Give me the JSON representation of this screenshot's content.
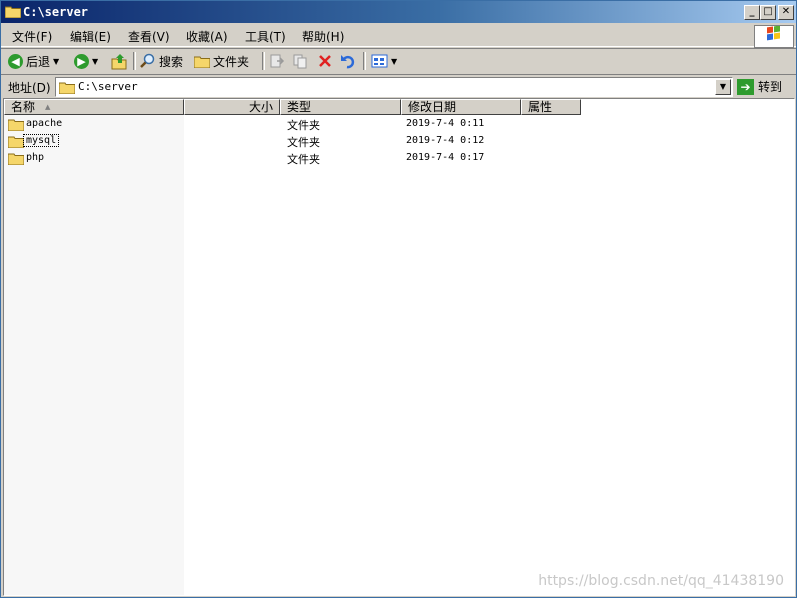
{
  "window": {
    "title": "C:\\server",
    "controls": {
      "minimize": "_",
      "maximize": "□",
      "close": "✕"
    }
  },
  "menu": [
    "文件(F)",
    "编辑(E)",
    "查看(V)",
    "收藏(A)",
    "工具(T)",
    "帮助(H)"
  ],
  "toolbar": {
    "back": "后退",
    "search": "搜索",
    "folders": "文件夹"
  },
  "address": {
    "label": "地址(D)",
    "value": "C:\\server",
    "go": "转到"
  },
  "columns": {
    "name": "名称",
    "size": "大小",
    "type": "类型",
    "modified": "修改日期",
    "attributes": "属性"
  },
  "files": [
    {
      "name": "apache",
      "type": "文件夹",
      "modified": "2019-7-4 0:11"
    },
    {
      "name": "mysql",
      "type": "文件夹",
      "modified": "2019-7-4 0:12"
    },
    {
      "name": "php",
      "type": "文件夹",
      "modified": "2019-7-4 0:17"
    }
  ],
  "watermark": "https://blog.csdn.net/qq_41438190",
  "colors": {
    "title_start": "#0a246a",
    "title_end": "#a6caf0",
    "chrome": "#d4d0c8",
    "folder": "#f5d66a"
  }
}
